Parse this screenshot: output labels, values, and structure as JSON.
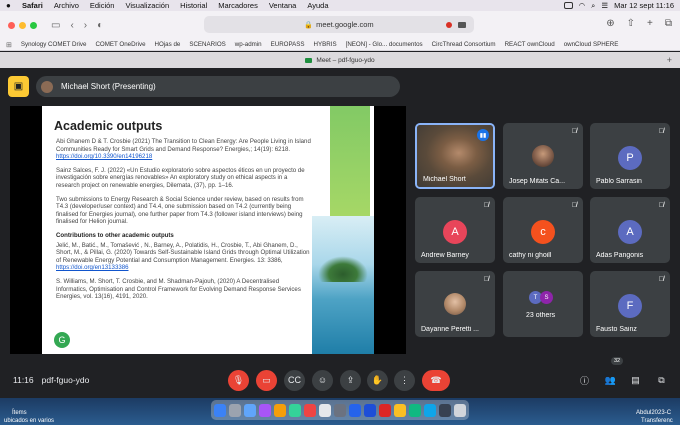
{
  "menubar": {
    "app": "Safari",
    "items": [
      "Archivo",
      "Edición",
      "Visualización",
      "Historial",
      "Marcadores",
      "Ventana",
      "Ayuda"
    ],
    "datetime": "Mar 12 sept  11:16"
  },
  "browser": {
    "url": "meet.google.com",
    "bookmarks": [
      "Synology COMET Drive",
      "COMET OneDrive",
      "HOjas de",
      "SCENARIOS",
      "wp-admin",
      "EUROPASS",
      "HYBRIS",
      "[NEON] - Glo... documentos",
      "CircThread Consortium",
      "REACT ownCloud",
      "ownCloud SPHERE"
    ],
    "tab_title": "Meet – pdf-fguo-ydo"
  },
  "meet": {
    "presenter_label": "Michael Short (Presenting)",
    "time": "11:16",
    "meeting_code": "pdf-fguo-ydo",
    "participant_count": "32",
    "slide": {
      "title": "Academic outputs",
      "p1": "Abi Ghanem D & T. Crosbie (2021) The Transition to Clean Energy: Are People Living in Island Communities Ready for Smart Grids and Demand Response? Energies,; 14(19): 6218.",
      "p1_link": "https://doi.org/10.3390/en14196218",
      "p2": "Sainz Salces, F. J. (2022) «Un Estudio exploratorio sobre aspectos éticos en un proyecto de investigación sobre energías renovables» An exploratory study on ethical aspects in a research project on renewable energies, Dilemata, (37), pp. 1–16.",
      "p3": "Two submissions to Energy Research & Social Science under review, based on results from T4.3 (developer/user context) and T4.4, one submission based on T4.2 (currently being finalised for Energies journal), one further paper from T4.3 (follower island interviews) being finalised for Helion journal.",
      "sub_heading": "Contributions to other academic outputs",
      "p4": "Jelić, M., Batić., M., Tomašević , N., Barney, A., Polatidis, H., Crosbie, T., Abi Ghanem, D., Short, M., & Pillai, G. (2020) Towards Self-Sustainable Island Grids through Optimal Utilization of Renewable Energy Potential and Consumption Management. Energies. 13: 3386,",
      "p4_link": "https://doi.org/en13133386",
      "p5": "S. Williams, M. Short, T. Crosbie, and M. Shadman-Pajouh, (2020) A Decentralised Informatics, Optimisation and Control Framework for Evolving Demand Response Services Energies, vol. 13(16), 4191, 2020."
    },
    "participants": [
      {
        "name": "Michael Short",
        "type": "video",
        "speaking": true
      },
      {
        "name": "Josep Mitats Ca...",
        "type": "photo"
      },
      {
        "name": "Pablo Sarrasin",
        "type": "avatar",
        "initial": "P",
        "color": "#5c6bc0"
      },
      {
        "name": "Andrew Barney",
        "type": "avatar",
        "initial": "A",
        "color": "#e8455a"
      },
      {
        "name": "cathy ni ghoill",
        "type": "avatar",
        "initial": "c",
        "color": "#f4511e"
      },
      {
        "name": "Adas Pangonis",
        "type": "avatar",
        "initial": "A",
        "color": "#5c6bc0"
      },
      {
        "name": "Dayanne Peretti ...",
        "type": "photo"
      },
      {
        "name": "23 others",
        "type": "group",
        "initials": [
          "T",
          "S"
        ]
      },
      {
        "name": "Fausto Sainz",
        "type": "avatar",
        "initial": "F",
        "color": "#5c6bc0"
      }
    ]
  },
  "desktop": {
    "items_label": "Ítems",
    "items_sub": "ubicados en varios",
    "right_label": "Abdul2023-C",
    "right_sub": "Transferenc"
  },
  "colors": {
    "meet_bg": "#202124",
    "tile_bg": "#3c4043",
    "end_call": "#ea4335",
    "present_icon": "#fcc934"
  }
}
